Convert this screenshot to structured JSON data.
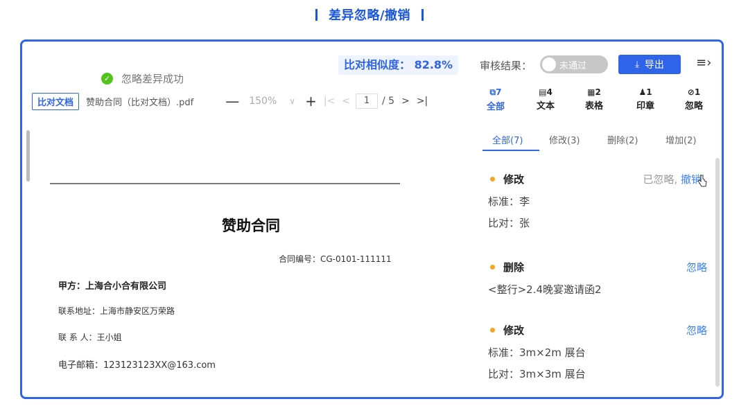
{
  "heading": "差异忽略/撤销",
  "toast": {
    "text": "忽略差异成功"
  },
  "doc_toolbar": {
    "tag": "比对文档",
    "filename": "赞助合同（比对文档）.pdf",
    "zoom_minus": "—",
    "zoom": "150%",
    "zoom_dropdown": "∨",
    "zoom_plus": "+",
    "first": "|<",
    "prev": "<",
    "page": "1",
    "total": "/ 5",
    "next": ">",
    "last": ">|"
  },
  "document": {
    "title": "赞助合同",
    "contract_no": "合同编号：CG-0101-111111",
    "party_a": "甲方：上海合小合有限公司",
    "address": "联系地址：上海市静安区万荣路",
    "contact": "联  系  人：王小姐",
    "email": "电子邮箱：123123123XX@163.com"
  },
  "header": {
    "similarity": "比对相似度：  82.8%",
    "review_label": "审核结果：",
    "review_toggle": "未通过",
    "export": "导出"
  },
  "stats": [
    {
      "count": "7",
      "label": "全部",
      "icon": "diff-icon"
    },
    {
      "count": "4",
      "label": "文本",
      "icon": "text-icon"
    },
    {
      "count": "2",
      "label": "表格",
      "icon": "table-icon"
    },
    {
      "count": "1",
      "label": "印章",
      "icon": "stamp-icon"
    },
    {
      "count": "1",
      "label": "忽略",
      "icon": "ignore-icon"
    }
  ],
  "tabs": [
    "全部(7)",
    "修改(3)",
    "删除(2)",
    "增加(2)"
  ],
  "diffs": [
    {
      "type": "修改",
      "status": "已忽略,",
      "action": "撤销",
      "line1": "标准：李",
      "line2": "比对：张"
    },
    {
      "type": "删除",
      "action": "忽略",
      "line1": "<整行>2.4晚宴邀请函2"
    },
    {
      "type": "修改",
      "action": "忽略",
      "line1": "标准：3m×2m 展台",
      "line2": "比对：3m×3m 展台"
    }
  ],
  "colors": {
    "accent": "#2f63e8",
    "success": "#52c41a",
    "dot": "#f5a623"
  }
}
